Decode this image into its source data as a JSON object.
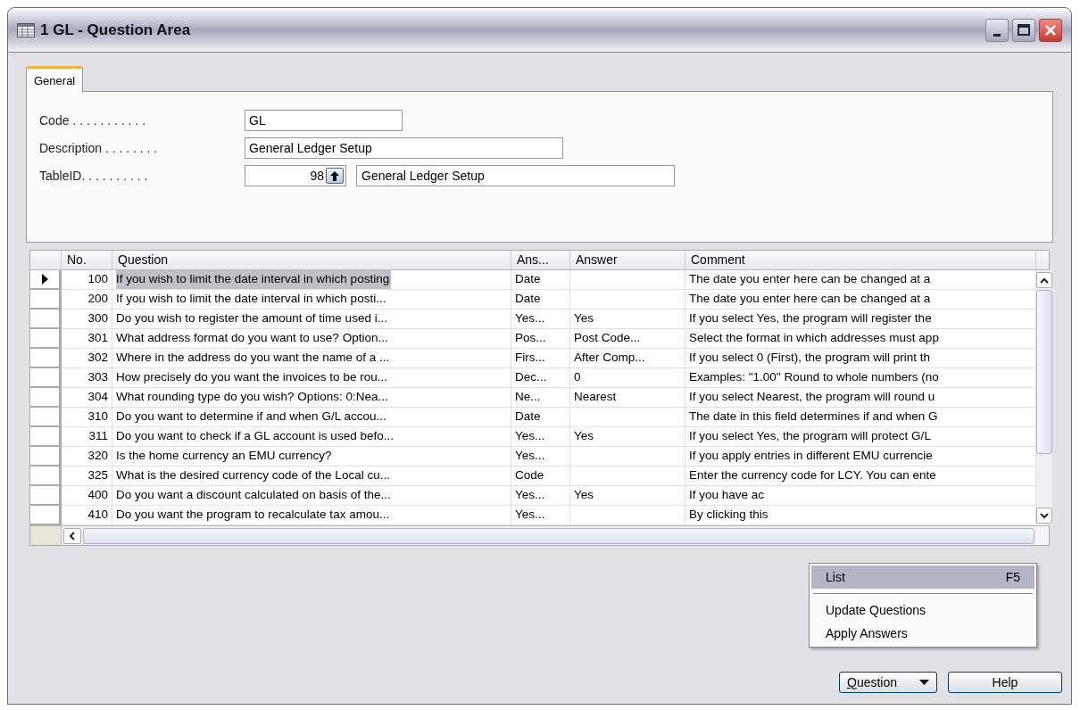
{
  "window": {
    "title": "1 GL - Question Area"
  },
  "tabs": [
    {
      "label": "General",
      "selected": true
    }
  ],
  "fields": [
    {
      "label": "Code . . . . . . . . . . .",
      "value": "GL",
      "kind": "text"
    },
    {
      "label": "Description . . . . . . . .",
      "value": "General Ledger Setup",
      "kind": "text"
    },
    {
      "label": "TableID. . . . . . . . . .",
      "value": "98",
      "lookup": "General Ledger Setup",
      "kind": "lookup"
    }
  ],
  "table": {
    "columns": [
      "No.",
      "Question",
      "Ans...",
      "Answer",
      "Comment"
    ],
    "rows": [
      {
        "selected": true,
        "cells": [
          "100",
          "If you wish to limit the date interval in which posting",
          "Date",
          "",
          "The date you enter here can be changed at a"
        ]
      },
      {
        "selected": false,
        "cells": [
          "200",
          "If you wish to limit the date interval in which posti...",
          "Date",
          "",
          "The date you enter here can be changed at a"
        ]
      },
      {
        "selected": false,
        "cells": [
          "300",
          "Do you wish to register the amount of time used i...",
          "Yes...",
          "Yes",
          "If you select Yes, the program will register the"
        ]
      },
      {
        "selected": false,
        "cells": [
          "301",
          "What address format do you want to use? Option...",
          "Pos...",
          "Post Code...",
          "Select the format in which addresses must app"
        ]
      },
      {
        "selected": false,
        "cells": [
          "302",
          "Where in the address do you want the name of a ...",
          "Firs...",
          "After Comp...",
          "If you select 0 (First), the program will print th"
        ]
      },
      {
        "selected": false,
        "cells": [
          "303",
          "How precisely do you want the invoices to be rou...",
          "Dec...",
          "0",
          "Examples: \"1.00\" Round to whole numbers (no"
        ]
      },
      {
        "selected": false,
        "cells": [
          "304",
          "What rounding type do you wish? Options: 0:Nea...",
          "Ne...",
          "Nearest",
          "If you select Nearest, the program will round u"
        ]
      },
      {
        "selected": false,
        "cells": [
          "310",
          "Do you want to determine if and when G/L accou...",
          "Date",
          "",
          "The date in this field determines if and when G"
        ]
      },
      {
        "selected": false,
        "cells": [
          "311",
          "Do you want to check if a GL account is used befo...",
          "Yes...",
          "Yes",
          "If you select Yes, the program will protect G/L"
        ]
      },
      {
        "selected": false,
        "cells": [
          "320",
          "Is the home currency an EMU currency?",
          "Yes...",
          "",
          "If you apply entries in different EMU currencie"
        ]
      },
      {
        "selected": false,
        "cells": [
          "325",
          "What is the desired currency code of the Local cu...",
          "Code",
          "",
          "Enter the currency code for LCY. You can ente"
        ]
      },
      {
        "selected": false,
        "cells": [
          "400",
          "Do you want a discount calculated on basis of the...",
          "Yes...",
          "Yes",
          "If you have ac"
        ]
      },
      {
        "selected": false,
        "cells": [
          "410",
          "Do you want the program to recalculate tax amou...",
          "Yes...",
          "",
          "By clicking this"
        ]
      }
    ]
  },
  "menu": {
    "items": [
      {
        "label": "List",
        "shortcut": "F5",
        "selected": true
      },
      {
        "label": "Update Questions",
        "selected": false
      },
      {
        "label": "Apply Answers",
        "selected": false
      }
    ]
  },
  "buttons": [
    {
      "label": "Question",
      "kind": "dropdown"
    },
    {
      "label": "Help",
      "kind": "plain"
    }
  ]
}
